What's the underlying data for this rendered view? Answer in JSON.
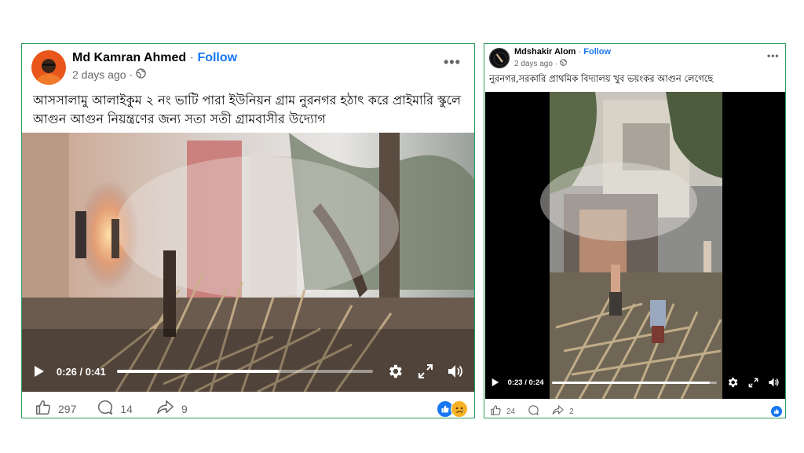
{
  "post1": {
    "author": "Md Kamran Ahmed",
    "separator": "·",
    "follow": "Follow",
    "time": "2 days ago",
    "caption": "আসসালামু আলাইকুম ২ নং ভাটি পারা ইউনিয়ন গ্রাম নুরনগর হঠাৎ করে প্রাইমারি স্কুলে আগুন আগুন নিয়ন্ত্রণের জন্য সতা সতী গ্রামবাসীর উদ্যোগ",
    "video_time": "0:26 / 0:41",
    "progress": 0.634,
    "likes": "297",
    "comments": "14",
    "shares": "9"
  },
  "post2": {
    "author": "Mdshakir Alom",
    "separator": "·",
    "follow": "Follow",
    "time": "2 days ago",
    "caption": "নুরনগর,সরকারি প্রাথমিক বিদ্যালয় খুব ভয়ংকর আগুন লেগেছে",
    "video_time": "0:23 / 0:24",
    "progress": 0.958,
    "likes": "24",
    "shares": "2"
  },
  "icons": {
    "globe": "globe-icon",
    "more": "more-icon",
    "play": "play-icon",
    "settings": "gear-icon",
    "fullscreen": "fullscreen-icon",
    "volume": "volume-icon",
    "like": "like-icon",
    "comment": "comment-icon",
    "share": "share-icon"
  },
  "colors": {
    "follow": "#1877f2",
    "border": "#2e9c5a",
    "meta": "#65676b"
  }
}
